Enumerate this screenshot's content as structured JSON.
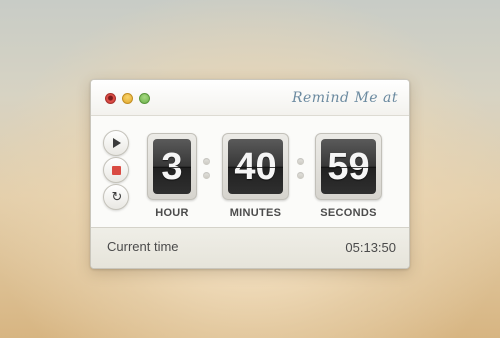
{
  "window": {
    "title": "Remind Me at",
    "traffic_lights": [
      "close",
      "minimize",
      "zoom"
    ]
  },
  "controls": {
    "play_icon": "play-icon",
    "stop_icon": "stop-icon",
    "reset_icon": "reset-icon",
    "reset_glyph": "↻"
  },
  "timer": {
    "hour": {
      "value": "3",
      "label": "HOUR"
    },
    "minutes": {
      "value": "40",
      "label": "MINUTES"
    },
    "seconds": {
      "value": "59",
      "label": "SECONDS"
    }
  },
  "footer": {
    "label": "Current time",
    "time": "05:13:50"
  },
  "colors": {
    "accent_title": "#6b8aa0",
    "flip_card": "#2f2f2f",
    "stop": "#d94a42",
    "close": "#e0504a",
    "minimize": "#e0a72c",
    "zoom": "#6cb14a"
  }
}
